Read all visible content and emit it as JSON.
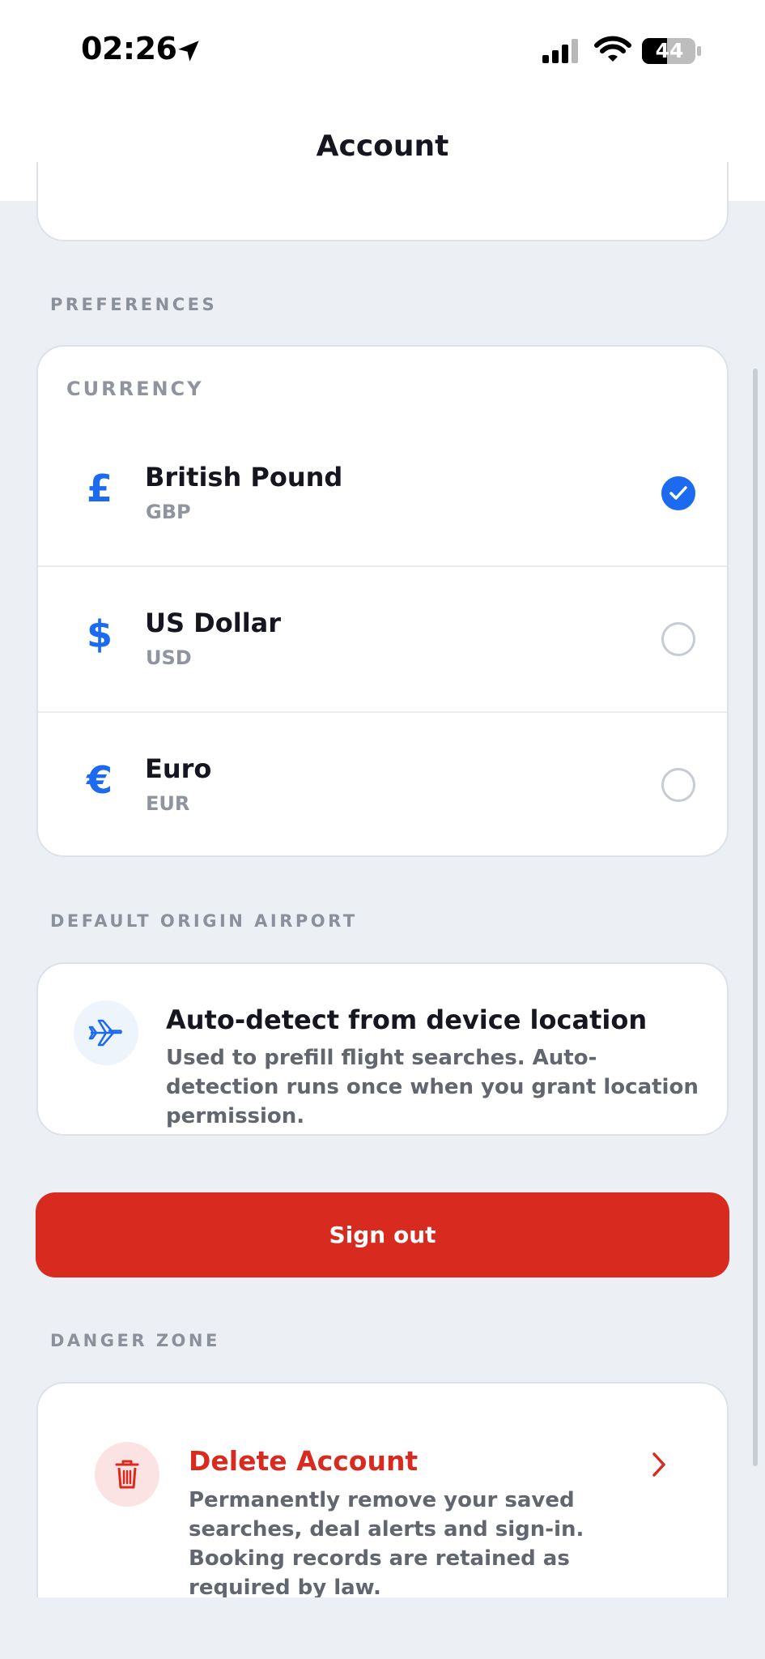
{
  "status_bar": {
    "time": "02:26",
    "battery": "44"
  },
  "header": {
    "title": "Account"
  },
  "preferences": {
    "section_label": "PREFERENCES",
    "currency_heading": "CURRENCY",
    "currencies": [
      {
        "symbol": "£",
        "name": "British Pound",
        "code": "GBP",
        "selected": true
      },
      {
        "symbol": "$",
        "name": "US Dollar",
        "code": "USD",
        "selected": false
      },
      {
        "symbol": "€",
        "name": "Euro",
        "code": "EUR",
        "selected": false
      }
    ]
  },
  "airport": {
    "section_label": "DEFAULT ORIGIN AIRPORT",
    "title": "Auto-detect from device location",
    "description": "Used to prefill flight searches. Auto-detection runs once when you grant location permission."
  },
  "actions": {
    "sign_out": "Sign out"
  },
  "danger": {
    "section_label": "DANGER ZONE",
    "delete_title": "Delete Account",
    "delete_description": "Permanently remove your saved searches, deal alerts and sign-in. Booking records are retained as required by law."
  },
  "colors": {
    "accent": "#1b6af0",
    "danger": "#d92a1f",
    "background": "#ecf0f5"
  }
}
